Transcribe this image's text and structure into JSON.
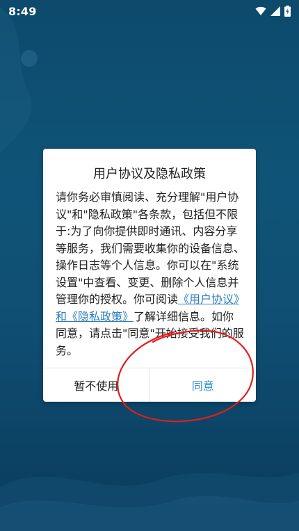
{
  "status_bar": {
    "time": "8:49",
    "icons": [
      "wifi-icon",
      "signal-icon",
      "battery-charging-icon"
    ]
  },
  "dialog": {
    "title": "用户协议及隐私政策",
    "body_before_link": "请你务必审慎阅读、充分理解\"用户协议\"和\"隐私政策\"各条款，包括但不限于:为了向你提供即时通讯、内容分享等服务，我们需要收集你的设备信息、操作日志等个人信息。你可以在\"系统设置\"中查看、变更、删除个人信息并管理你的授权。你可阅读",
    "link_text": "《用户协议》和《隐私政策》",
    "body_after_link": "了解详细信息。如你同意，请点击\"同意\"开始接受我们的服务。",
    "decline_label": "暂不使用",
    "accept_label": "同意"
  },
  "colors": {
    "background": "#0f5478",
    "accent": "#2b8fd6",
    "link": "#2b7bbf",
    "annotation": "#e11d1d"
  }
}
